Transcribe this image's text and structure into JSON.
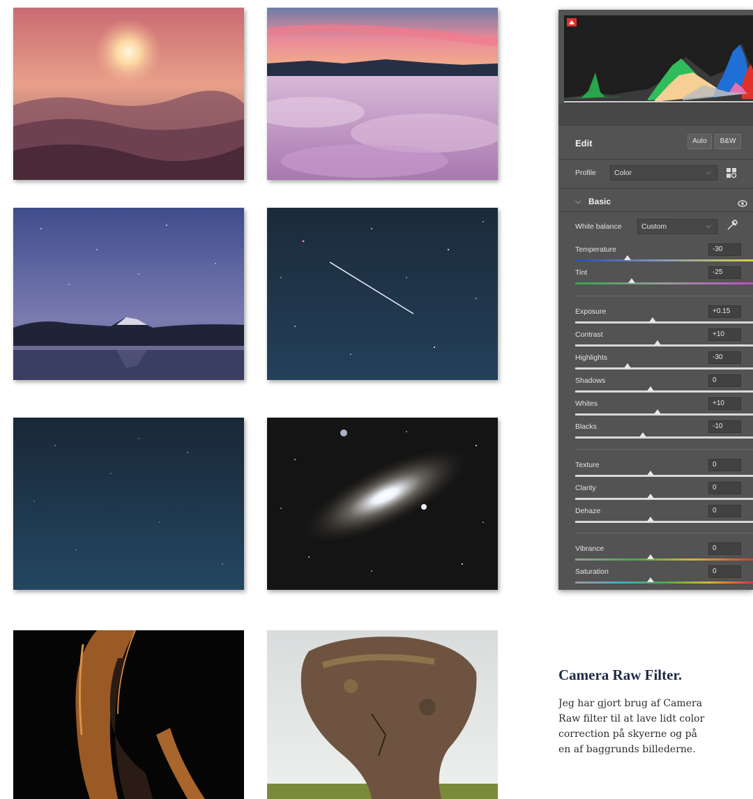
{
  "gallery": {
    "photos": [
      {
        "name": "sunset-mountains-photo"
      },
      {
        "name": "cloud-sea-photo"
      },
      {
        "name": "mount-fuji-lake-photo"
      },
      {
        "name": "meteor-night-sky-photo"
      },
      {
        "name": "starry-blue-sky-photo"
      },
      {
        "name": "andromeda-galaxy-photo"
      },
      {
        "name": "woman-profile-photo"
      },
      {
        "name": "boulder-rock-photo"
      }
    ]
  },
  "panel": {
    "edit_title": "Edit",
    "auto_label": "Auto",
    "bw_label": "B&W",
    "profile_label": "Profile",
    "profile_value": "Color",
    "basic_label": "Basic",
    "white_balance_label": "White balance",
    "white_balance_value": "Custom",
    "colors": {
      "accent": "#e0312b",
      "panel": "#535353",
      "histogram_bg": "#1e1e1e"
    },
    "sliders": [
      {
        "label": "Temperature",
        "value": "-30",
        "level": 0.35
      },
      {
        "label": "Tint",
        "value": "-25",
        "level": 0.375
      },
      {
        "label": "Exposure",
        "value": "+0.15",
        "level": 0.515
      },
      {
        "label": "Contrast",
        "value": "+10",
        "level": 0.55
      },
      {
        "label": "Highlights",
        "value": "-30",
        "level": 0.35
      },
      {
        "label": "Shadows",
        "value": "0",
        "level": 0.5
      },
      {
        "label": "Whites",
        "value": "+10",
        "level": 0.55
      },
      {
        "label": "Blacks",
        "value": "-10",
        "level": 0.45
      },
      {
        "label": "Texture",
        "value": "0",
        "level": 0.5
      },
      {
        "label": "Clarity",
        "value": "0",
        "level": 0.5
      },
      {
        "label": "Dehaze",
        "value": "0",
        "level": 0.5
      },
      {
        "label": "Vibrance",
        "value": "0",
        "level": 0.5
      },
      {
        "label": "Saturation",
        "value": "0",
        "level": 0.5
      }
    ]
  },
  "caption": {
    "heading": "Camera Raw Filter.",
    "lines": [
      "Jeg har gjort brug af Camera",
      "Raw filter til at lave lidt color",
      "correction på skyerne og på",
      "en af baggrunds billederne."
    ]
  }
}
